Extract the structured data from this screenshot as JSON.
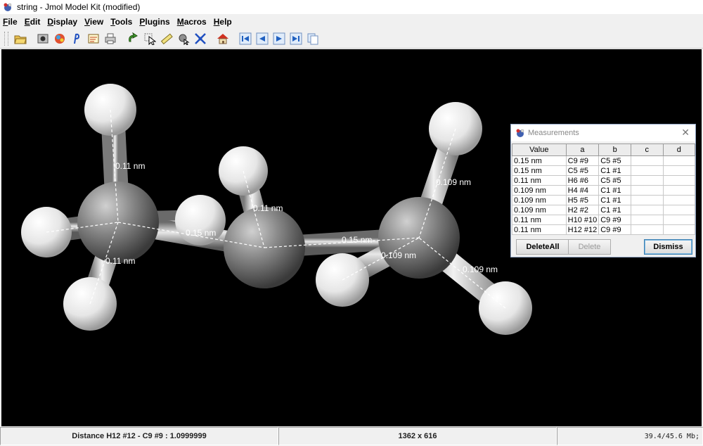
{
  "window": {
    "title": "string - Jmol Model Kit (modified)"
  },
  "menu": [
    {
      "key": "F",
      "rest": "ile"
    },
    {
      "key": "E",
      "rest": "dit"
    },
    {
      "key": "D",
      "rest": "isplay"
    },
    {
      "key": "V",
      "rest": "iew"
    },
    {
      "key": "T",
      "rest": "ools"
    },
    {
      "key": "P",
      "rest": "lugins"
    },
    {
      "key": "M",
      "rest": "acros"
    },
    {
      "key": "H",
      "rest": "elp"
    }
  ],
  "toolbar_icons": [
    "open-icon",
    "screenshot-icon",
    "pov-render-icon",
    "script-editor-icon",
    "script-console-icon",
    "print-icon",
    "rotate-icon",
    "pick-icon",
    "measure-icon",
    "model-kit-icon",
    "zoom-fit-icon",
    "home-icon",
    "first-frame-icon",
    "prev-frame-icon",
    "next-frame-icon",
    "last-frame-icon",
    "copy-icon"
  ],
  "measure_labels": [
    "0.11 nm",
    "0.11 nm",
    "0.15 nm",
    "0.11 nm",
    "0.15 nm",
    "0.109 nm",
    "0.109 nm",
    "0.109 nm"
  ],
  "dialog": {
    "title": "Measurements",
    "columns": [
      "Value",
      "a",
      "b",
      "c",
      "d"
    ],
    "rows": [
      [
        "0.15 nm",
        "C9 #9",
        "C5 #5",
        "",
        ""
      ],
      [
        "0.15 nm",
        "C5 #5",
        "C1 #1",
        "",
        ""
      ],
      [
        "0.11 nm",
        "H6 #6",
        "C5 #5",
        "",
        ""
      ],
      [
        "0.109 nm",
        "H4 #4",
        "C1 #1",
        "",
        ""
      ],
      [
        "0.109 nm",
        "H5 #5",
        "C1 #1",
        "",
        ""
      ],
      [
        "0.109 nm",
        "H2 #2",
        "C1 #1",
        "",
        ""
      ],
      [
        "0.11 nm",
        "H10 #10",
        "C9 #9",
        "",
        ""
      ],
      [
        "0.11 nm",
        "H12 #12",
        "C9 #9",
        "",
        ""
      ]
    ],
    "buttons": {
      "delete_all": "DeleteAll",
      "delete": "Delete",
      "dismiss": "Dismiss"
    }
  },
  "status": {
    "measurement": "Distance H12 #12 - C9 #9 : 1.0999999",
    "size": "1362 x 616",
    "memory": "39.4/45.6 Mb;"
  },
  "colors": {
    "background": "#000000",
    "carbon": "#909090",
    "hydrogen": "#ffffff",
    "measure_line": "#ffffff"
  }
}
